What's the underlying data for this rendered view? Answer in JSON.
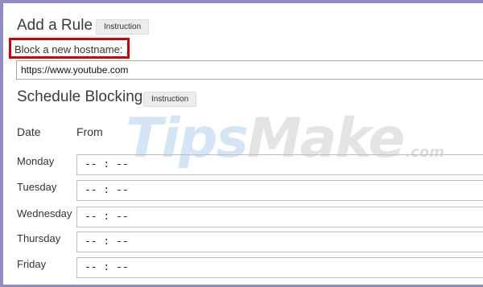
{
  "add_rule": {
    "title": "Add a Rule",
    "instruction_label": "Instruction",
    "hostname_label": "Block a new hostname:",
    "hostname_value": "https://www.youtube.com"
  },
  "schedule": {
    "title": "Schedule Blocking",
    "instruction_label": "Instruction",
    "col_date": "Date",
    "col_from": "From",
    "days": [
      {
        "day": "Monday",
        "from": "-- : --"
      },
      {
        "day": "Tuesday",
        "from": "-- : --"
      },
      {
        "day": "Wednesday",
        "from": "-- : --"
      },
      {
        "day": "Thursday",
        "from": "-- : --"
      },
      {
        "day": "Friday",
        "from": "-- : --"
      }
    ]
  },
  "watermark": {
    "part1": "Tips",
    "part2": "Make",
    "part3": ".com"
  },
  "colors": {
    "border": "#8e8ec4",
    "highlight": "#d40000"
  }
}
